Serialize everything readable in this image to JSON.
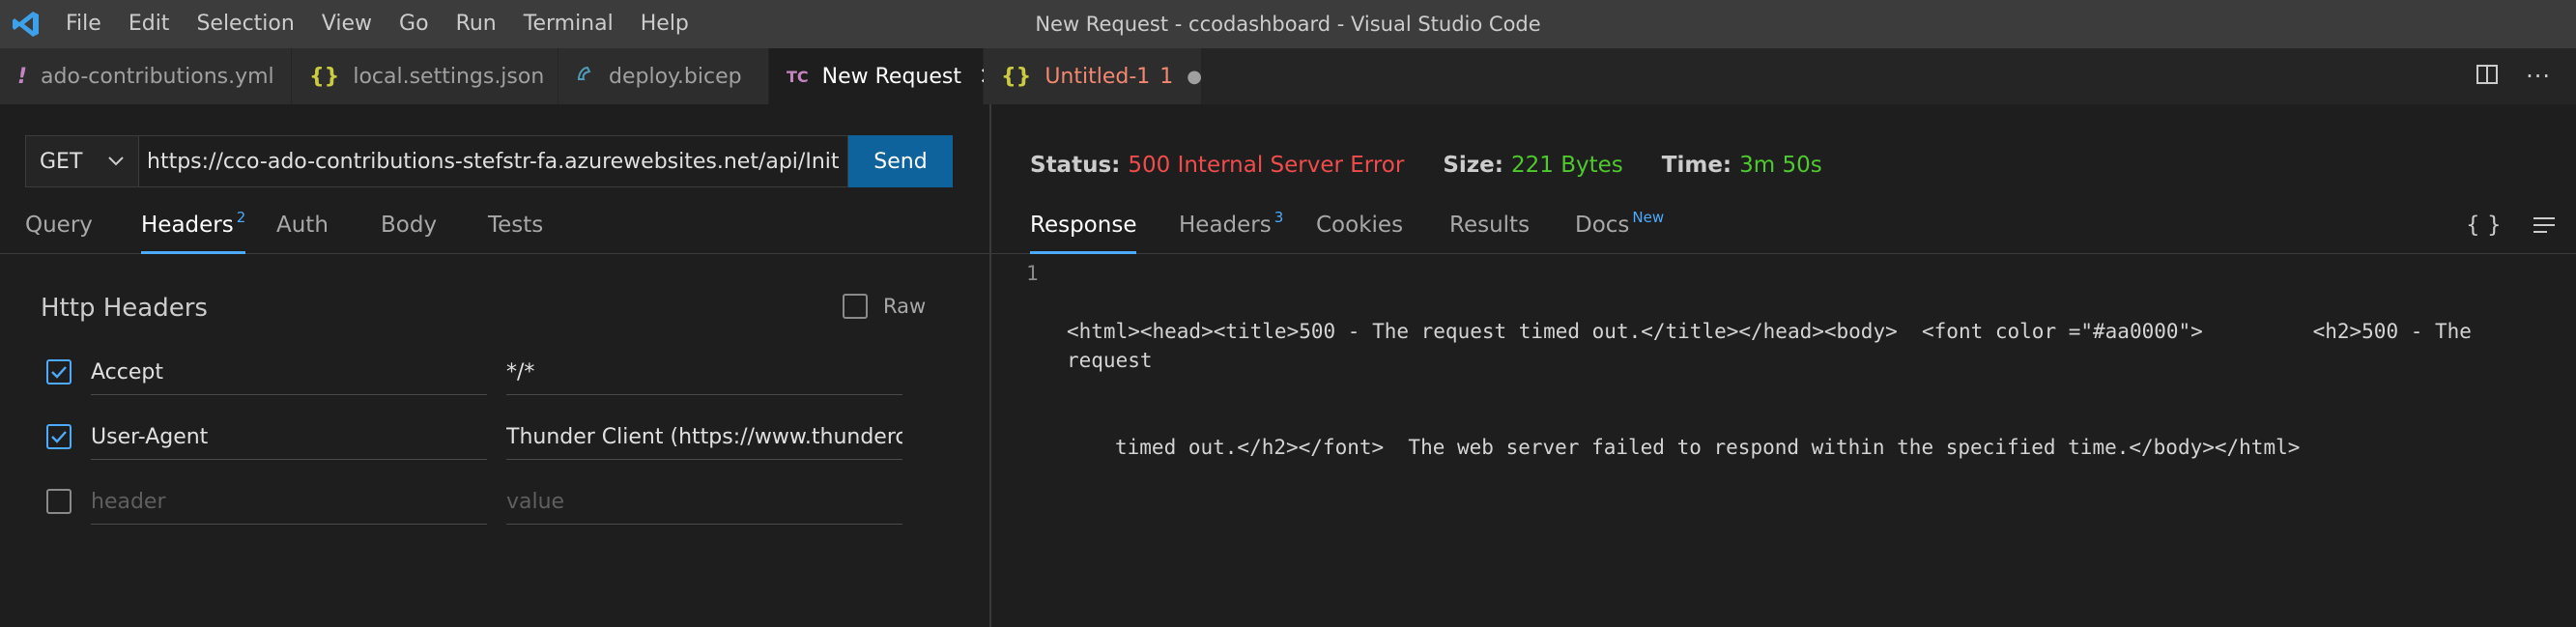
{
  "window": {
    "title": "New Request - ccodashboard - Visual Studio Code"
  },
  "menu": [
    "File",
    "Edit",
    "Selection",
    "View",
    "Go",
    "Run",
    "Terminal",
    "Help"
  ],
  "tabs": [
    {
      "icon": "!",
      "label": "ado-contributions.yml",
      "color": "#c586c0"
    },
    {
      "icon": "{}",
      "label": "local.settings.json",
      "color": "#cbcb41"
    },
    {
      "icon": "bicep",
      "label": "deploy.bicep",
      "color": "#519aba"
    },
    {
      "icon": "TC",
      "label": "New Request",
      "color": "#c586c0"
    },
    {
      "icon": "{}",
      "label": "Untitled-1",
      "badge": "1",
      "color": "#cbcb41"
    }
  ],
  "request": {
    "method": "GET",
    "url": "https://cco-ado-contributions-stefstr-fa.azurewebsites.net/api/InitializeTables",
    "send_label": "Send",
    "tabs": [
      {
        "label": "Query"
      },
      {
        "label": "Headers",
        "badge": "2"
      },
      {
        "label": "Auth"
      },
      {
        "label": "Body"
      },
      {
        "label": "Tests"
      }
    ],
    "section_title": "Http Headers",
    "raw_label": "Raw",
    "headers": [
      {
        "checked": true,
        "key": "Accept",
        "value": "*/*"
      },
      {
        "checked": true,
        "key": "User-Agent",
        "value": "Thunder Client (https://www.thunderclient.com)"
      }
    ],
    "new_header": {
      "key_placeholder": "header",
      "value_placeholder": "value"
    }
  },
  "response": {
    "status_label": "Status:",
    "status_value": "500 Internal Server Error",
    "size_label": "Size:",
    "size_value": "221 Bytes",
    "time_label": "Time:",
    "time_value": "3m 50s",
    "tabs": [
      {
        "label": "Response"
      },
      {
        "label": "Headers",
        "badge": "3"
      },
      {
        "label": "Cookies"
      },
      {
        "label": "Results"
      },
      {
        "label": "Docs",
        "badge": "New"
      }
    ],
    "code_actions": "{ }",
    "line_number": "1",
    "body_line1": "<html><head><title>500 - The request timed out.</title></head><body>  <font color =\"#aa0000\">         <h2>500 - The request",
    "body_line2": "timed out.</h2></font>  The web server failed to respond within the specified time.</body></html>"
  },
  "colors": {
    "accent": "#4daafc",
    "error": "#f14c4c",
    "success": "#4ec92e",
    "button": "#0e639c"
  }
}
